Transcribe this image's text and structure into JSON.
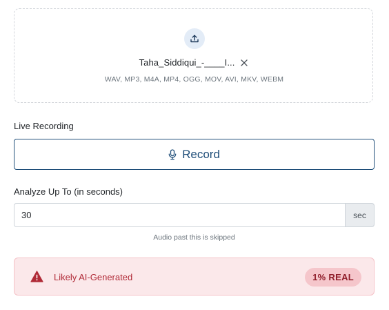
{
  "upload": {
    "icon": "upload-icon",
    "file_name": "Taha_Siddiqui_-____I...",
    "remove_icon": "close-icon",
    "formats": "WAV, MP3, M4A, MP4, OGG, MOV, AVI, MKV, WEBM"
  },
  "live_recording": {
    "label": "Live Recording",
    "button_label": "Record",
    "button_icon": "microphone-icon"
  },
  "analyze": {
    "label": "Analyze Up To (in seconds)",
    "value": "30",
    "unit": "sec",
    "hint": "Audio past this is skipped"
  },
  "result": {
    "icon": "warning-icon",
    "text": "Likely AI-Generated",
    "badge": "1% REAL"
  },
  "colors": {
    "accent": "#1f4e79",
    "danger_text": "#b02a37",
    "danger_bg": "#fbe8ea",
    "badge_bg": "#f5c6cb"
  }
}
